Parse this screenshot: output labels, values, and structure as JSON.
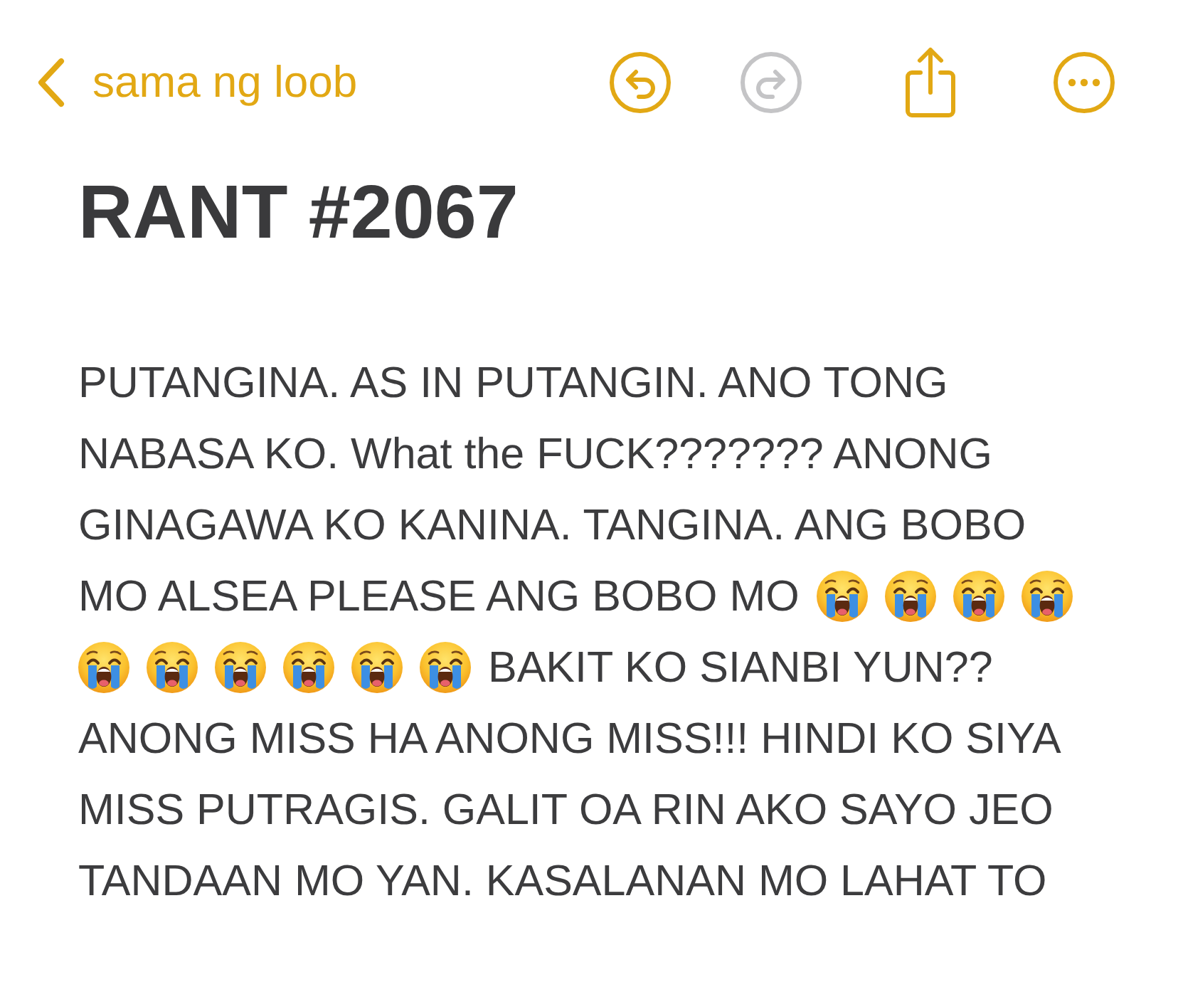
{
  "header": {
    "back_label": "sama ng loob",
    "toolbar": [
      {
        "kind": "undo",
        "disabled": false
      },
      {
        "kind": "redo",
        "disabled": true
      },
      {
        "kind": "share",
        "disabled": false
      },
      {
        "kind": "more",
        "disabled": false
      }
    ]
  },
  "note": {
    "title": "RANT #2067",
    "lines": [
      {
        "segments": [
          {
            "kind": "text",
            "text": "PUTANGINA. AS IN PUTANGIN. ANO TONG"
          }
        ]
      },
      {
        "segments": [
          {
            "kind": "text",
            "text": "NABASA KO. What the FUCK??????? ANONG"
          }
        ]
      },
      {
        "segments": [
          {
            "kind": "text",
            "text": "GINAGAWA KO KANINA. TANGINA. ANG BOBO"
          }
        ]
      },
      {
        "segments": [
          {
            "kind": "text",
            "text": "MO ALSEA PLEASE ANG BOBO MO"
          },
          {
            "kind": "emoji"
          },
          {
            "kind": "emoji"
          },
          {
            "kind": "emoji"
          },
          {
            "kind": "emoji"
          }
        ]
      },
      {
        "segments": [
          {
            "kind": "emoji"
          },
          {
            "kind": "emoji"
          },
          {
            "kind": "emoji"
          },
          {
            "kind": "emoji"
          },
          {
            "kind": "emoji"
          },
          {
            "kind": "emoji"
          },
          {
            "kind": "text",
            "text": "BAKIT KO SIANBI YUN??"
          }
        ]
      },
      {
        "segments": [
          {
            "kind": "text",
            "text": "ANONG MISS HA ANONG MISS!!! HINDI KO SIYA"
          }
        ]
      },
      {
        "segments": [
          {
            "kind": "text",
            "text": "MISS PUTRAGIS. GALIT OA RIN AKO SAYO JEO"
          }
        ]
      },
      {
        "segments": [
          {
            "kind": "text",
            "text": "TANDAAN MO YAN. KASALANAN MO LAHAT TO"
          }
        ]
      }
    ]
  }
}
